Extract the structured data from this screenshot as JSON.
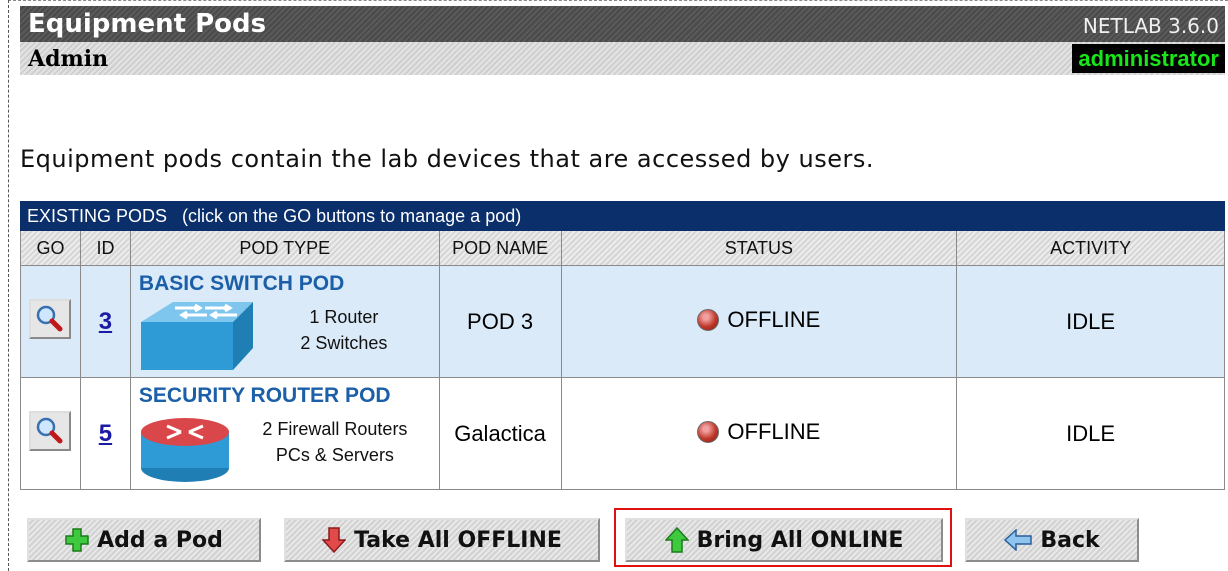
{
  "header": {
    "title": "Equipment Pods",
    "version": "NETLAB 3.6.0",
    "section": "Admin",
    "user": "administrator"
  },
  "intro_text": "Equipment pods contain the lab devices that are accessed by users.",
  "table": {
    "caption": "EXISTING PODS   (click on the GO buttons to manage a pod)",
    "columns": [
      "GO",
      "ID",
      "POD TYPE",
      "POD NAME",
      "STATUS",
      "ACTIVITY"
    ],
    "rows": [
      {
        "id": "3",
        "type_name": "BASIC SWITCH POD",
        "type_line1": "1 Router",
        "type_line2": "2 Switches",
        "pod_name": "POD 3",
        "status": "OFFLINE",
        "activity": "IDLE",
        "icon": "switch-icon"
      },
      {
        "id": "5",
        "type_name": "SECURITY ROUTER POD",
        "type_line1": "2 Firewall Routers",
        "type_line2": "PCs & Servers",
        "pod_name": "Galactica",
        "status": "OFFLINE",
        "activity": "IDLE",
        "icon": "router-icon"
      }
    ]
  },
  "buttons": {
    "add": "Add a Pod",
    "take_offline": "Take All OFFLINE",
    "bring_online": "Bring All ONLINE",
    "back": "Back"
  },
  "colors": {
    "caption_bg": "#0a2f6b",
    "user_text": "#19e619",
    "highlight": "#e01010",
    "row_highlight": "#dbeaf8"
  }
}
